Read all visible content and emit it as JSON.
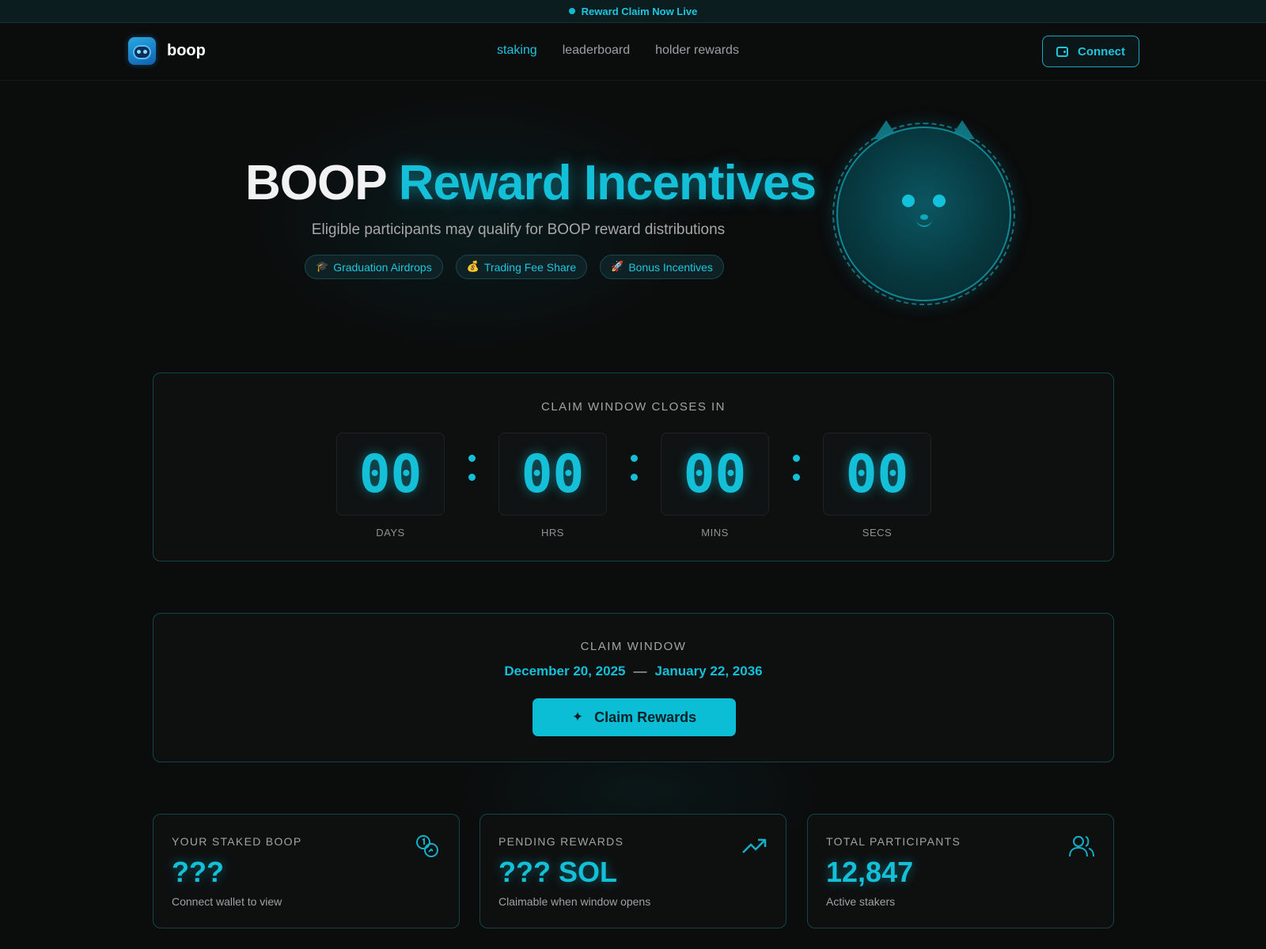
{
  "announcement": {
    "text": "Reward Claim Now Live"
  },
  "brand": {
    "name": "boop"
  },
  "nav": {
    "links": [
      {
        "label": "staking",
        "active": true
      },
      {
        "label": "leaderboard",
        "active": false
      },
      {
        "label": "holder rewards",
        "active": false
      }
    ],
    "connect_label": "Connect"
  },
  "hero": {
    "title_white": "BOOP",
    "title_accent": "Reward Incentives",
    "subtitle": "Eligible participants may qualify for BOOP reward distributions",
    "pills": [
      {
        "emoji": "🎓",
        "label": "Graduation Airdrops"
      },
      {
        "emoji": "💰",
        "label": "Trading Fee Share"
      },
      {
        "emoji": "🚀",
        "label": "Bonus Incentives"
      }
    ]
  },
  "countdown": {
    "label": "CLAIM WINDOW CLOSES IN",
    "units": [
      {
        "value": "00",
        "label": "DAYS"
      },
      {
        "value": "00",
        "label": "HRS"
      },
      {
        "value": "00",
        "label": "MINS"
      },
      {
        "value": "00",
        "label": "SECS"
      }
    ]
  },
  "claim_window": {
    "label": "CLAIM WINDOW",
    "start": "December 20, 2025",
    "separator": "—",
    "end": "January 22, 2036",
    "button_label": "Claim Rewards"
  },
  "stats": [
    {
      "label": "YOUR STAKED BOOP",
      "value": "???",
      "sub": "Connect wallet to view",
      "icon": "coins-icon"
    },
    {
      "label": "PENDING REWARDS",
      "value": "??? SOL",
      "sub": "Claimable when window opens",
      "icon": "trending-up-icon"
    },
    {
      "label": "TOTAL PARTICIPANTS",
      "value": "12,847",
      "sub": "Active stakers",
      "icon": "users-icon"
    }
  ],
  "colors": {
    "accent": "#14bfd8",
    "background": "#0b0c0c",
    "card_border": "#14444b"
  }
}
